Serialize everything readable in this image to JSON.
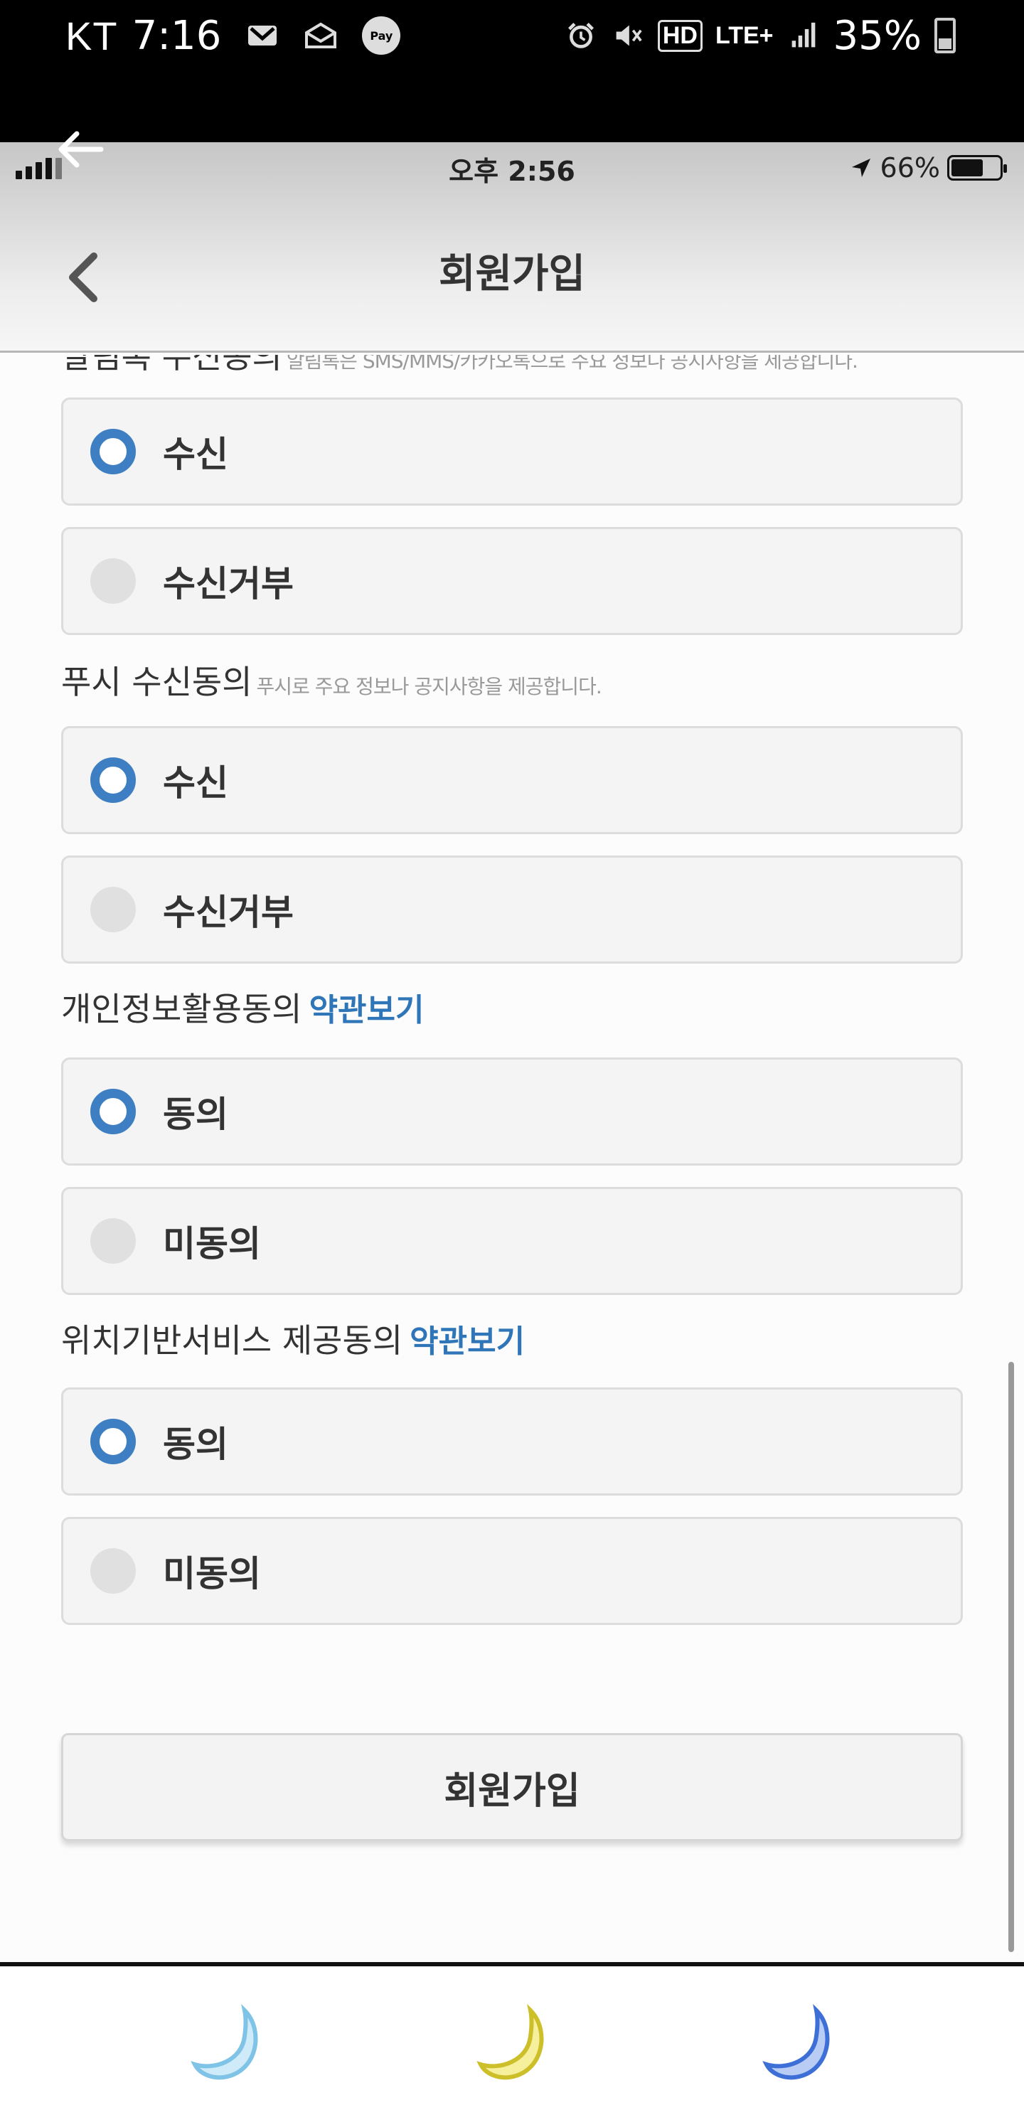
{
  "android_status": {
    "carrier": "KT",
    "time": "7:16",
    "network": "LTE+",
    "hd": "HD",
    "pay": "Pay",
    "battery": "35%"
  },
  "ios_status": {
    "time": "오후 2:56",
    "battery": "66%"
  },
  "header": {
    "title": "회원가입"
  },
  "sections": [
    {
      "label": "알림톡 수신동의",
      "hint": "알림톡은 SMS/MMS/카카오톡으로 주요 정보나 공지사항을 제공합니다.",
      "options": [
        {
          "label": "수신",
          "selected": true
        },
        {
          "label": "수신거부",
          "selected": false
        }
      ]
    },
    {
      "label": "푸시 수신동의",
      "hint": "푸시로 주요 정보나 공지사항을 제공합니다.",
      "options": [
        {
          "label": "수신",
          "selected": true
        },
        {
          "label": "수신거부",
          "selected": false
        }
      ]
    },
    {
      "label": "개인정보활용동의",
      "link": "약관보기",
      "options": [
        {
          "label": "동의",
          "selected": true
        },
        {
          "label": "미동의",
          "selected": false
        }
      ]
    },
    {
      "label": "위치기반서비스 제공동의",
      "link": "약관보기",
      "options": [
        {
          "label": "동의",
          "selected": true
        },
        {
          "label": "미동의",
          "selected": false
        }
      ]
    }
  ],
  "submit_label": "회원가입",
  "colors": {
    "accent": "#3d7fc2",
    "link": "#2f76b8",
    "moon_1": "#7fc3e6",
    "moon_2": "#e6d84a",
    "moon_3": "#3d6fd6"
  }
}
